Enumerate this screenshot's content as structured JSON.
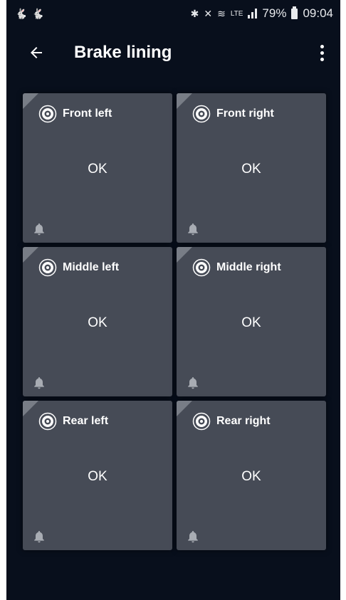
{
  "statusbar": {
    "left_icons": [
      "rabbit-notification-icon",
      "rabbit-notification-icon"
    ],
    "right_icons": [
      "bluetooth-icon",
      "mute-icon",
      "wifi-icon",
      "lte-icon",
      "signal-icon",
      "battery-icon"
    ],
    "lte": "LTE",
    "battery_percent": "79%",
    "time": "09:04"
  },
  "appbar": {
    "back_icon": "arrow-left-icon",
    "title": "Brake lining",
    "menu_icon": "more-vert-icon"
  },
  "tiles": [
    {
      "label": "Front left",
      "status": "OK"
    },
    {
      "label": "Front right",
      "status": "OK"
    },
    {
      "label": "Middle left",
      "status": "OK"
    },
    {
      "label": "Middle right",
      "status": "OK"
    },
    {
      "label": "Rear left",
      "status": "OK"
    },
    {
      "label": "Rear right",
      "status": "OK"
    }
  ],
  "tile_icons": {
    "disc": "brake-disc-icon",
    "alert": "bell-icon"
  },
  "colors": {
    "background": "#080f1c",
    "tile": "#464b56",
    "text": "#ffffff"
  }
}
